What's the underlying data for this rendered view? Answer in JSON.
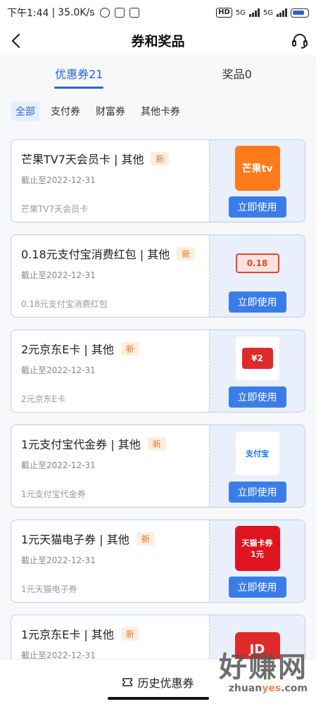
{
  "status_bar": {
    "time": "下午1:44",
    "speed": "35.0K/s",
    "hd": "HD",
    "net1": "5G",
    "net2": "5G"
  },
  "nav": {
    "title": "券和奖品"
  },
  "tabs": [
    {
      "label": "优惠券21",
      "active": true
    },
    {
      "label": "奖品0",
      "active": false
    }
  ],
  "filters": [
    {
      "label": "全部",
      "active": true
    },
    {
      "label": "支付券",
      "active": false
    },
    {
      "label": "财富券",
      "active": false
    },
    {
      "label": "其他卡券",
      "active": false
    }
  ],
  "coupons": [
    {
      "title": "芒果TV7天会员卡 | 其他",
      "badge": "新",
      "expire": "截止至2022-12-31",
      "desc": "芒果TV7天会员卡",
      "button": "立即使用",
      "thumb_text": "芒果tv",
      "thumb_color": "#ff7a1a"
    },
    {
      "title": "0.18元支付宝消费红包 | 其他",
      "badge": "新",
      "expire": "截止至2022-12-31",
      "desc": "0.18元支付宝消费红包",
      "button": "立即使用",
      "thumb_text": "0.18",
      "thumb_color": "#e8452f"
    },
    {
      "title": "2元京东E卡 | 其他",
      "badge": "新",
      "expire": "截止至2022-12-31",
      "desc": "2元京东E卡",
      "button": "立即使用",
      "thumb_text": "¥2",
      "thumb_color": "#e02a2a"
    },
    {
      "title": "1元支付宝代金券 | 其他",
      "badge": "新",
      "expire": "截止至2022-12-31",
      "desc": "1元支付宝代金券",
      "button": "立即使用",
      "thumb_text": "支付宝",
      "thumb_color": "#1677ff"
    },
    {
      "title": "1元天猫电子券 | 其他",
      "badge": "新",
      "expire": "截止至2022-12-31",
      "desc": "1元天猫电子券",
      "button": "立即使用",
      "thumb_text": "天猫卡券 1元",
      "thumb_color": "#e0141e"
    },
    {
      "title": "1元京东E卡 | 其他",
      "badge": "新",
      "expire": "截止至2022-12-31",
      "desc": "",
      "button": "",
      "thumb_text": "JD",
      "thumb_color": "#e02a2a"
    }
  ],
  "bottom": {
    "history_label": "历史优惠券"
  },
  "watermark": {
    "big": "好赚网",
    "small_a": "zhuan",
    "small_b": "yes",
    "small_c": ".com"
  },
  "colors": {
    "accent": "#2a63d9",
    "button": "#3b7de8",
    "badge_text": "#e8752c"
  }
}
